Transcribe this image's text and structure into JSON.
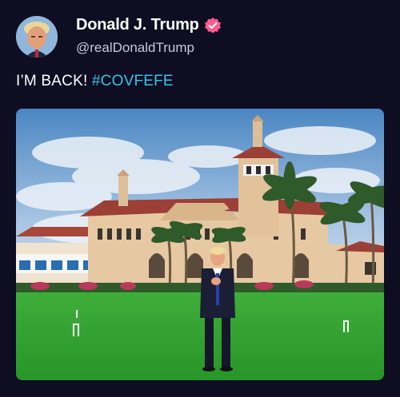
{
  "post": {
    "author": {
      "display_name": "Donald J. Trump",
      "handle": "@realDonaldTrump",
      "verified_badge_icon": "verified-badge-icon",
      "verified_color": "#ff5a8c"
    },
    "text": {
      "main": "I’M BACK! ",
      "hashtag": "#COVFEFE"
    },
    "media": {
      "type": "photo",
      "subject": "man in suit standing on lawn in front of estate"
    }
  },
  "colors": {
    "background": "#0f0d22",
    "hashtag": "#32c5e8",
    "text": "#ffffff",
    "handle": "#c9c9d6"
  }
}
